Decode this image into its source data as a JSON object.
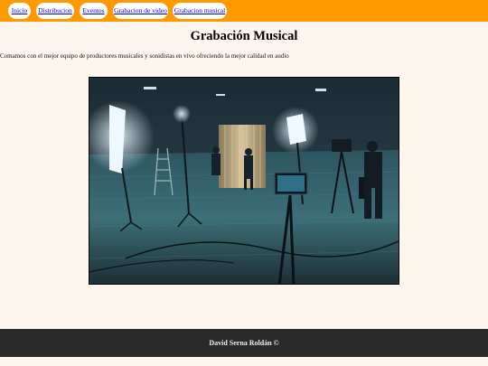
{
  "nav": {
    "items": [
      {
        "label": "Inicio"
      },
      {
        "label": "Distribucion"
      },
      {
        "label": "Eventos"
      },
      {
        "label": "Grabacion de video"
      },
      {
        "label": "Grabacion musical"
      }
    ]
  },
  "main": {
    "title": "Grabación Musical",
    "intro": "Comamos con el mejor equipo de productores musicales y sonidistas en vivo ofreciendo la mejor calidad en audio"
  },
  "footer": {
    "credit": "David Serna Roldán ©"
  },
  "colors": {
    "navbar": "#ff9900",
    "page_background": "#fdf6ef",
    "footer_background": "#2a2a2a",
    "link": "#0000ee"
  }
}
